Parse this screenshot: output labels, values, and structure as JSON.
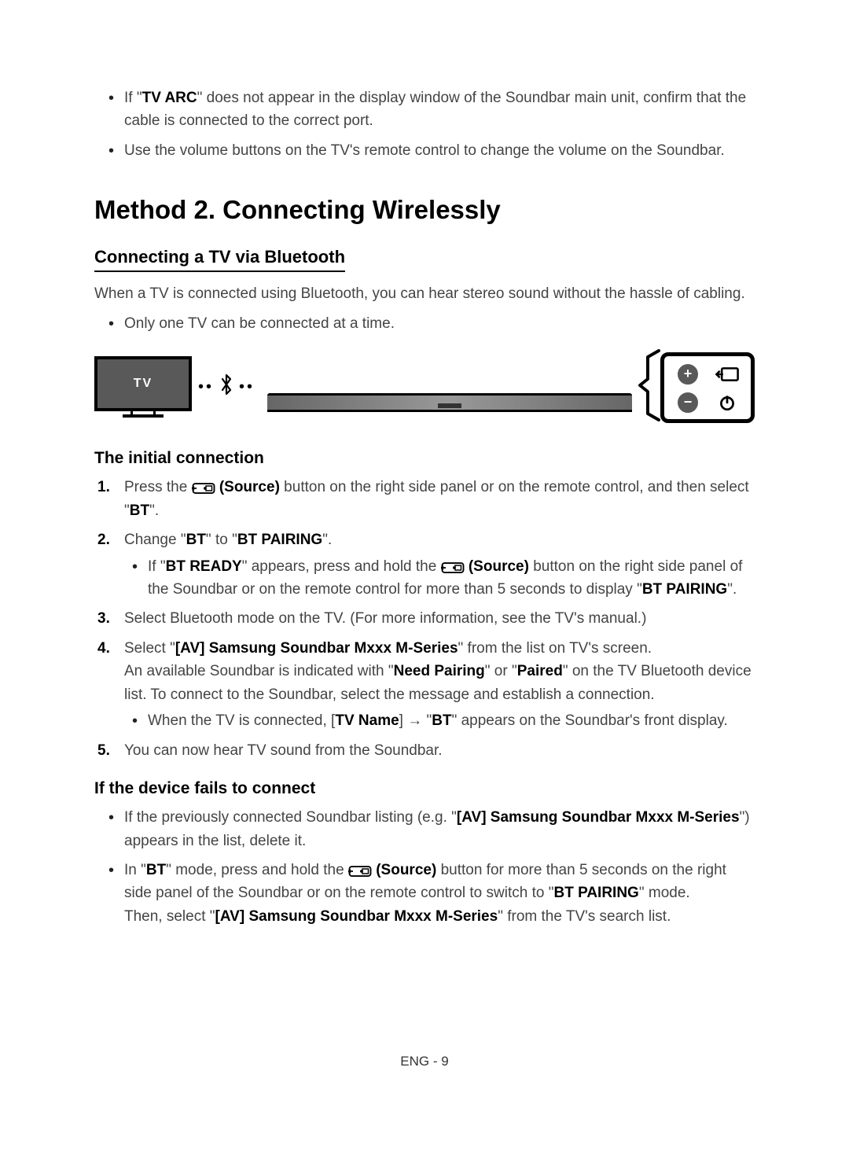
{
  "preNotes": {
    "item1_prefix": "If \"",
    "item1_bold1": "TV ARC",
    "item1_suffix": "\" does not appear in the display window of the Soundbar main unit, confirm that the cable is connected to the correct port.",
    "item2": "Use the volume buttons on the TV's remote control to change the volume on the Soundbar."
  },
  "h2": "Method 2. Connecting Wirelessly",
  "h3": "Connecting a TV via Bluetooth",
  "intro": "When a TV is connected using Bluetooth, you can hear stereo sound without the hassle of cabling.",
  "introBullet": "Only one TV can be connected at a time.",
  "diagram": {
    "tvLabel": "TV"
  },
  "h4a": "The initial connection",
  "steps": {
    "s1_a": "Press the ",
    "s1_bold": "(Source)",
    "s1_b": " button on the right side panel or on the remote control, and then select \"",
    "s1_bt": "BT",
    "s1_c": "\".",
    "s2_a": "Change \"",
    "s2_bt": "BT",
    "s2_b": "\" to \"",
    "s2_btp": "BT PAIRING",
    "s2_c": "\".",
    "s2_sub_a": "If \"",
    "s2_sub_btr": "BT READY",
    "s2_sub_b": "\" appears, press and hold the ",
    "s2_sub_src": "(Source)",
    "s2_sub_c": " button on the right side panel of the Soundbar or on the remote control for more than 5 seconds to display \"",
    "s2_sub_btp": "BT PAIRING",
    "s2_sub_d": "\".",
    "s3": "Select Bluetooth mode on the TV. (For more information, see the TV's manual.)",
    "s4_a": "Select \"",
    "s4_bold": "[AV] Samsung Soundbar Mxxx M-Series",
    "s4_b": "\" from the list on TV's screen.",
    "s4_line2_a": "An available Soundbar is indicated with \"",
    "s4_np": "Need Pairing",
    "s4_line2_b": "\" or \"",
    "s4_paired": "Paired",
    "s4_line2_c": "\" on the TV Bluetooth device list. To connect to the Soundbar, select the message and establish a connection.",
    "s4_sub_a": "When the TV is connected, [",
    "s4_sub_tvname": "TV Name",
    "s4_sub_b": "] → \"",
    "s4_sub_bt": "BT",
    "s4_sub_c": "\" appears on the Soundbar's front display.",
    "s5": "You can now hear TV sound from the Soundbar."
  },
  "h4b": "If the device fails to connect",
  "fail": {
    "f1_a": "If the previously connected Soundbar listing (e.g. \"",
    "f1_bold": "[AV] Samsung Soundbar Mxxx M-Series",
    "f1_b": "\") appears in the list, delete it.",
    "f2_a": "In \"",
    "f2_bt": "BT",
    "f2_b": "\" mode, press and hold the ",
    "f2_src": "(Source)",
    "f2_c": " button for more than 5 seconds on the right side panel of the Soundbar or on the remote control to switch to \"",
    "f2_btp": "BT PAIRING",
    "f2_d": "\" mode.",
    "f2_line2_a": "Then, select \"",
    "f2_line2_bold": "[AV] Samsung Soundbar Mxxx M-Series",
    "f2_line2_b": "\" from the TV's search list."
  },
  "footer": "ENG - 9"
}
